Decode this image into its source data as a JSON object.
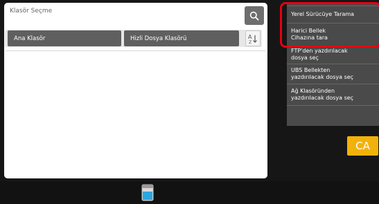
{
  "panel": {
    "title": "Klasör Seçme",
    "icons": {
      "search": "search-icon",
      "sort": "sort-az-icon"
    }
  },
  "folders": {
    "ana": "Ana Klasör",
    "hizli": "Hizli Dosya Klasörü"
  },
  "right_menu": {
    "yerel": "Yerel Sürücüye Tarama",
    "harici_line1": "Harici Bellek",
    "harici_line2": "Cihazına tara",
    "ftp_line1": "FTP'den yazdırılacak",
    "ftp_line2": "dosya seç",
    "usb_line1": "UBS Bellekten",
    "usb_line2": "yazdırılacak dosya seç",
    "ag_line1": "Ağ Klasöründen",
    "ag_line2": "yazdırılacak dosya seç"
  },
  "ca_label": "CA",
  "colors": {
    "highlight": "#e60012",
    "ca": "#f2b20c",
    "toner": "#2aa7e0"
  },
  "status_icons": {
    "toner": "toner-level-icon"
  }
}
